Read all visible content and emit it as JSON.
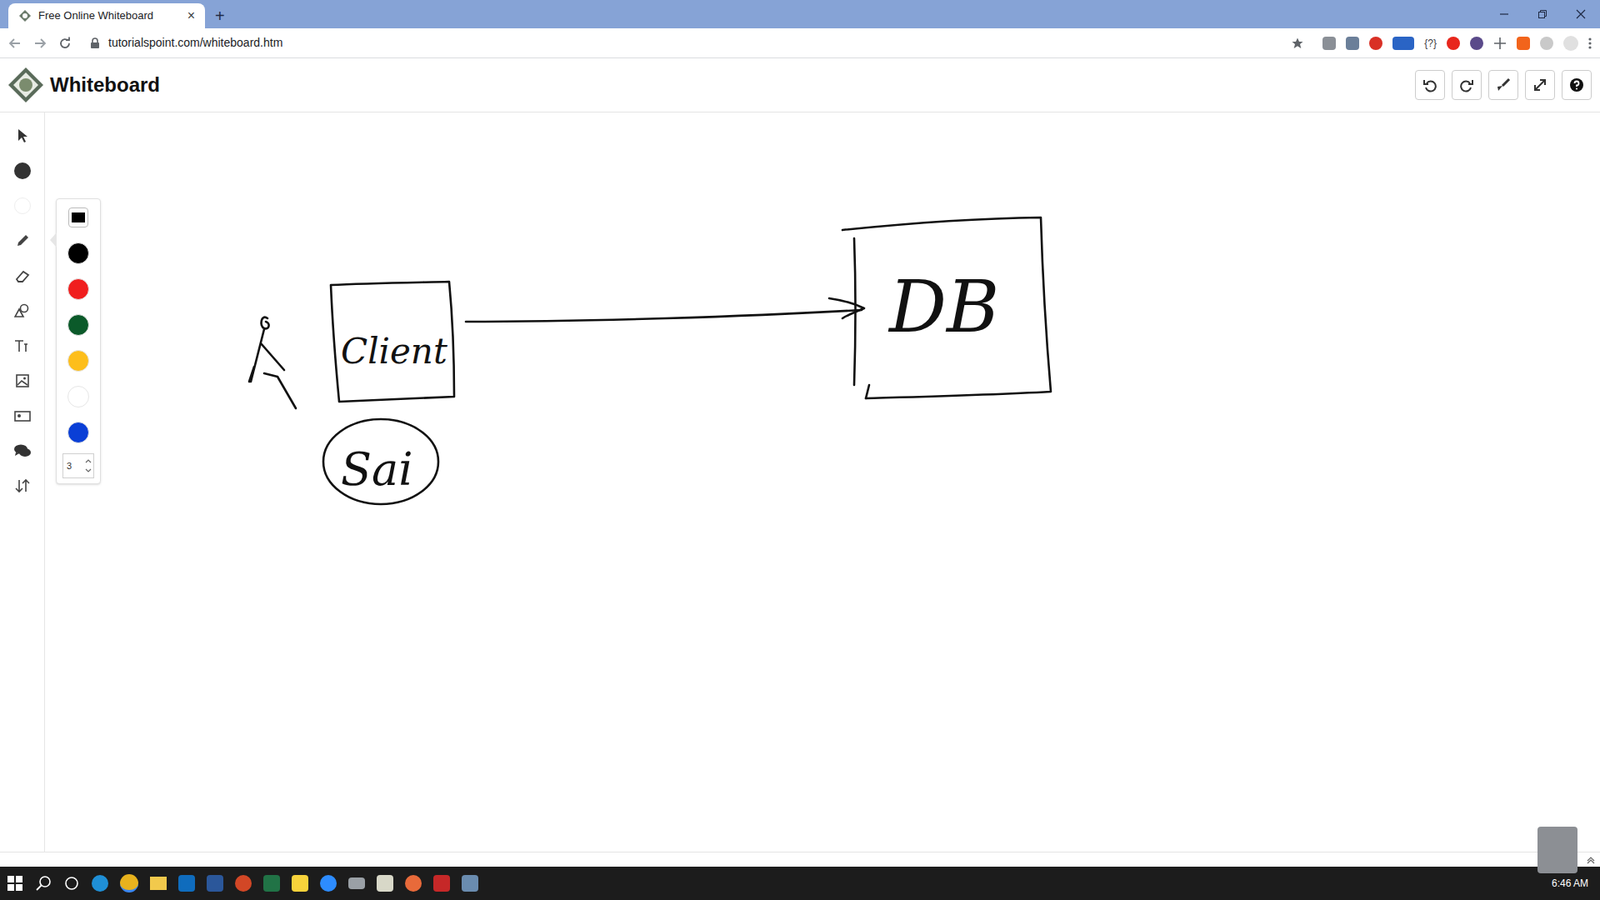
{
  "browser": {
    "tabs": [
      {
        "title": "Free Online Whiteboard",
        "close": "×",
        "selected": true
      }
    ],
    "new_tab": "+",
    "url": "tutorialspoint.com/whiteboard.htm",
    "extensions": [
      "{?}"
    ]
  },
  "app": {
    "title": "Whiteboard"
  },
  "palette": {
    "colors": [
      {
        "kind": "current",
        "color": "#000000",
        "selected": true
      },
      {
        "kind": "swatch",
        "color": "#000000",
        "selected": false
      },
      {
        "kind": "swatch",
        "color": "#f01e1e",
        "selected": false
      },
      {
        "kind": "swatch",
        "color": "#0b5a2a",
        "selected": false
      },
      {
        "kind": "swatch",
        "color": "#fdbe1b",
        "selected": false
      },
      {
        "kind": "swatch",
        "color": "#ffffff",
        "selected": false
      },
      {
        "kind": "swatch",
        "color": "#0a3fd6",
        "selected": false
      }
    ],
    "stroke_width": "3"
  },
  "canvas": {
    "labels": [
      "Client",
      "DB",
      "Sai"
    ]
  },
  "taskbar": {
    "time": "6:46 AM"
  }
}
